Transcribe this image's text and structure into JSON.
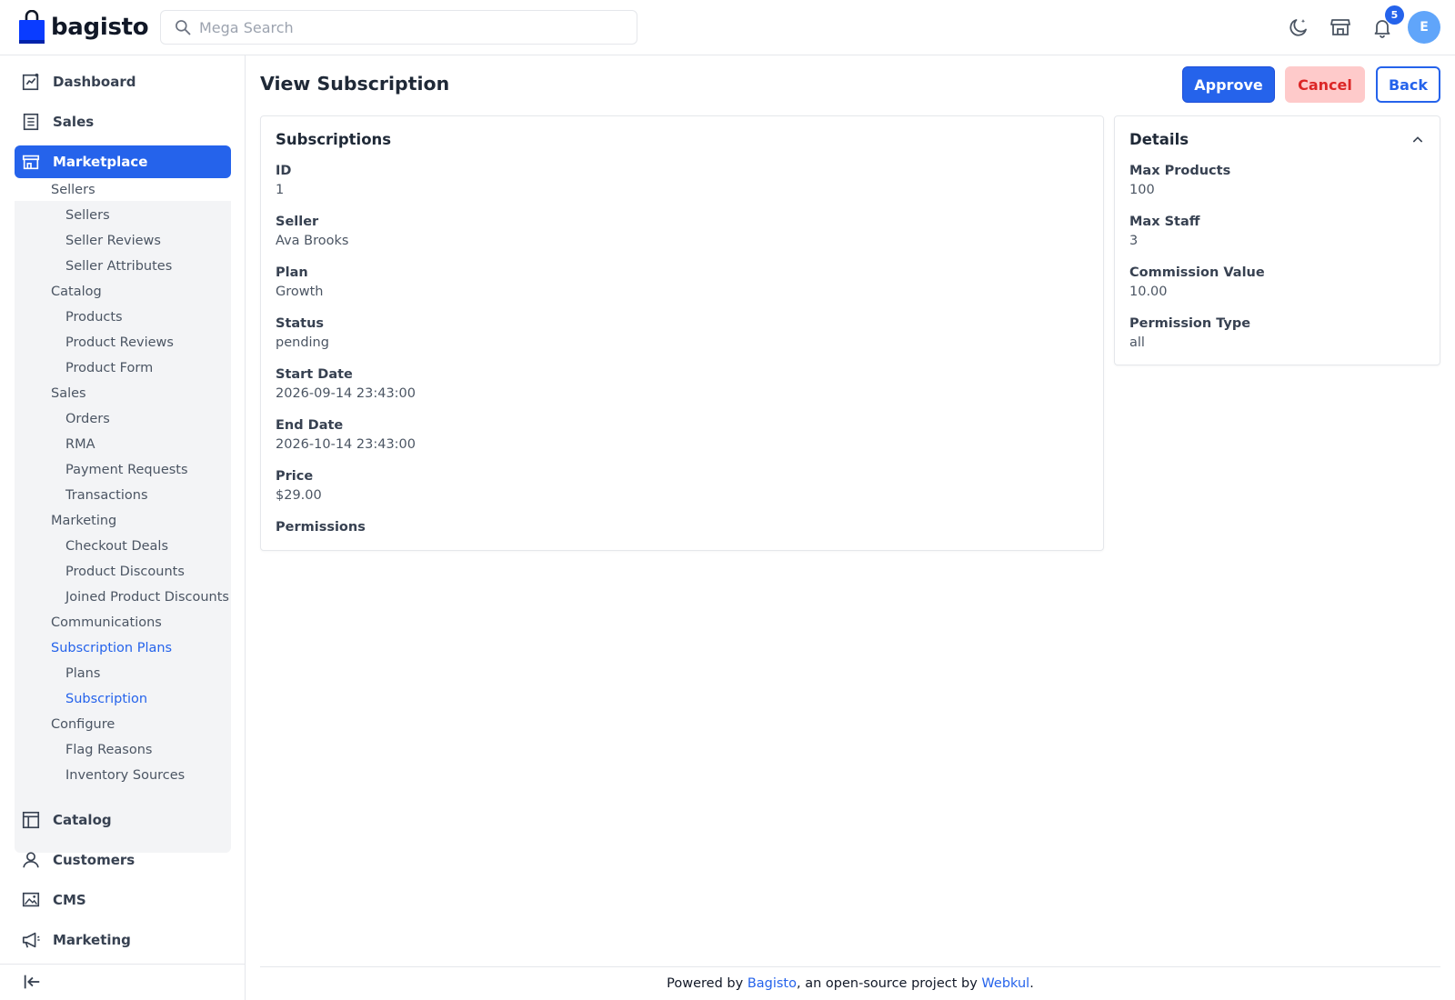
{
  "header": {
    "logo_text": "bagisto",
    "search_placeholder": "Mega Search",
    "notification_count": "5",
    "avatar_initial": "E"
  },
  "sidebar": {
    "top_items": [
      {
        "label": "Dashboard",
        "icon": "dashboard-icon"
      },
      {
        "label": "Sales",
        "icon": "receipt-icon"
      },
      {
        "label": "Marketplace",
        "icon": "store-icon"
      },
      {
        "label": "Catalog",
        "icon": "catalog-icon"
      },
      {
        "label": "Customers",
        "icon": "user-icon"
      },
      {
        "label": "CMS",
        "icon": "image-icon"
      },
      {
        "label": "Marketing",
        "icon": "megaphone-icon"
      }
    ],
    "marketplace_sub": [
      "Sellers",
      "Sellers",
      "Seller Reviews",
      "Seller Attributes",
      "Catalog",
      "Products",
      "Product Reviews",
      "Product Form",
      "Sales",
      "Orders",
      "RMA",
      "Payment Requests",
      "Transactions",
      "Marketing",
      "Checkout Deals",
      "Product Discounts",
      "Joined Product Discounts",
      "Communications",
      "Subscription Plans",
      "Plans",
      "Subscription",
      "Configure",
      "Flag Reasons",
      "Inventory Sources"
    ]
  },
  "page": {
    "title": "View Subscription",
    "approve_label": "Approve",
    "cancel_label": "Cancel",
    "back_label": "Back"
  },
  "subscriptions": {
    "title": "Subscriptions",
    "fields": [
      {
        "label": "ID",
        "value": "1"
      },
      {
        "label": "Seller",
        "value": "Ava Brooks"
      },
      {
        "label": "Plan",
        "value": "Growth"
      },
      {
        "label": "Status",
        "value": "pending"
      },
      {
        "label": "Start Date",
        "value": "2026-09-14 23:43:00"
      },
      {
        "label": "End Date",
        "value": "2026-10-14 23:43:00"
      },
      {
        "label": "Price",
        "value": "$29.00"
      },
      {
        "label": "Permissions",
        "value": ""
      }
    ]
  },
  "details": {
    "title": "Details",
    "fields": [
      {
        "label": "Max Products",
        "value": "100"
      },
      {
        "label": "Max Staff",
        "value": "3"
      },
      {
        "label": "Commission Value",
        "value": "10.00"
      },
      {
        "label": "Permission Type",
        "value": "all"
      }
    ]
  },
  "footer": {
    "prefix": "Powered by ",
    "link1": "Bagisto",
    "middle": ", an open-source project by ",
    "link2": "Webkul",
    "suffix": "."
  },
  "colors": {
    "accent": "#2563eb",
    "danger": "#dc2626",
    "danger_bg": "#fecaca"
  }
}
